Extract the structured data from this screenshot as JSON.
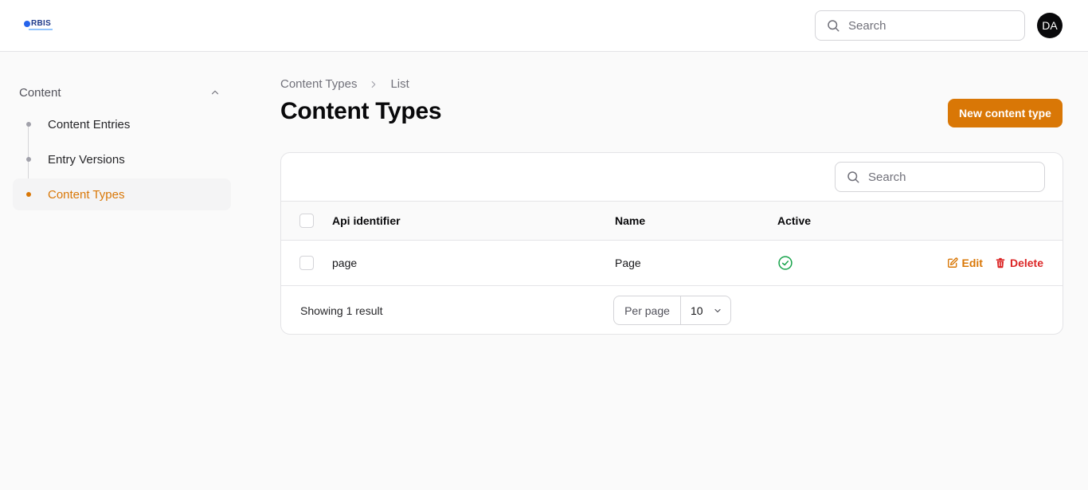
{
  "app": {
    "logo_text": "RBIS",
    "user_initials": "DA"
  },
  "header": {
    "search_placeholder": "Search"
  },
  "sidebar": {
    "group_label": "Content",
    "items": [
      {
        "label": "Content Entries",
        "active": false
      },
      {
        "label": "Entry Versions",
        "active": false
      },
      {
        "label": "Content Types",
        "active": true
      }
    ]
  },
  "breadcrumb": {
    "parent": "Content Types",
    "current": "List"
  },
  "page": {
    "title": "Content Types",
    "new_button_label": "New content type"
  },
  "table": {
    "search_placeholder": "Search",
    "columns": {
      "api_identifier": "Api identifier",
      "name": "Name",
      "active": "Active"
    },
    "rows": [
      {
        "api_identifier": "page",
        "name": "Page",
        "active": true,
        "edit_label": "Edit",
        "delete_label": "Delete"
      }
    ],
    "footer": {
      "showing_text": "Showing 1 result",
      "per_page_label": "Per page",
      "per_page_value": "10"
    }
  },
  "colors": {
    "accent": "#d97706",
    "danger": "#dc2626",
    "success": "#16a34a",
    "avatar_bg": "#09090b"
  }
}
